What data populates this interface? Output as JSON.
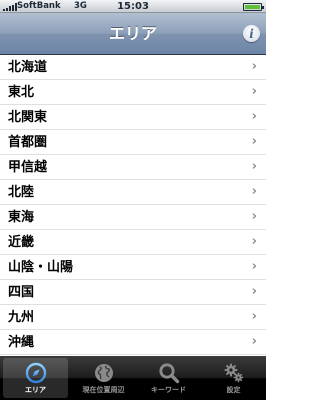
{
  "status_bar": {
    "carrier": "SoftBank",
    "network": "3G",
    "time": "15:03"
  },
  "nav_bar": {
    "title": "エリア",
    "info_icon": "info-icon",
    "info_glyph": "i"
  },
  "list": {
    "items": [
      {
        "label": "北海道",
        "chevron": "›"
      },
      {
        "label": "東北",
        "chevron": "›"
      },
      {
        "label": "北関東",
        "chevron": "›"
      },
      {
        "label": "首都圏",
        "chevron": "›"
      },
      {
        "label": "甲信越",
        "chevron": "›"
      },
      {
        "label": "北陸",
        "chevron": "›"
      },
      {
        "label": "東海",
        "chevron": "›"
      },
      {
        "label": "近畿",
        "chevron": "›"
      },
      {
        "label": "山陰・山陽",
        "chevron": "›"
      },
      {
        "label": "四国",
        "chevron": "›"
      },
      {
        "label": "九州",
        "chevron": "›"
      },
      {
        "label": "沖縄",
        "chevron": "›"
      }
    ]
  },
  "tab_bar": {
    "selected_index": 0,
    "tabs": [
      {
        "label": "エリア",
        "icon": "compass-icon"
      },
      {
        "label": "現在位置周辺",
        "icon": "globe-icon"
      },
      {
        "label": "キーワード",
        "icon": "search-icon"
      },
      {
        "label": "設定",
        "icon": "gear-icon"
      }
    ]
  },
  "colors": {
    "nav_bar": "#7f93af",
    "tab_bar": "#000000",
    "selected_tab_icon": "#5aa8f2"
  }
}
